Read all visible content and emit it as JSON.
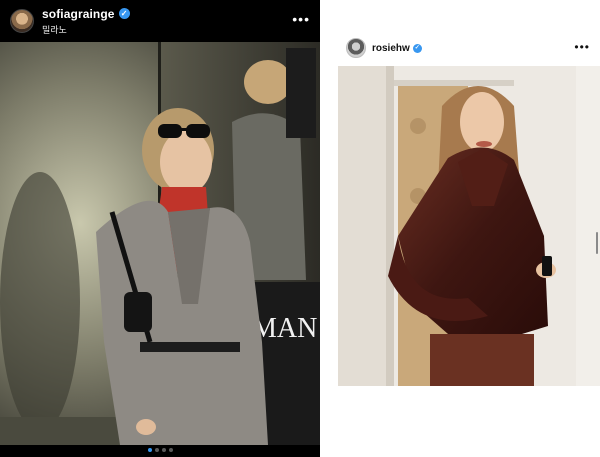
{
  "left_post": {
    "username": "sofiagrainge",
    "location": "밀라노",
    "verified_icon": "verified-badge-icon",
    "more_icon": "more-options-icon",
    "more_label": "•••",
    "sign_text": "MAN",
    "carousel": {
      "dots": 4,
      "active_index": 0
    }
  },
  "right_post": {
    "username": "rosiehw",
    "verified_icon": "verified-badge-icon",
    "more_icon": "more-options-icon",
    "more_label": "•••"
  },
  "colors": {
    "verified_blue": "#3897f0",
    "dark_background": "#000000",
    "light_background": "#ffffff"
  }
}
